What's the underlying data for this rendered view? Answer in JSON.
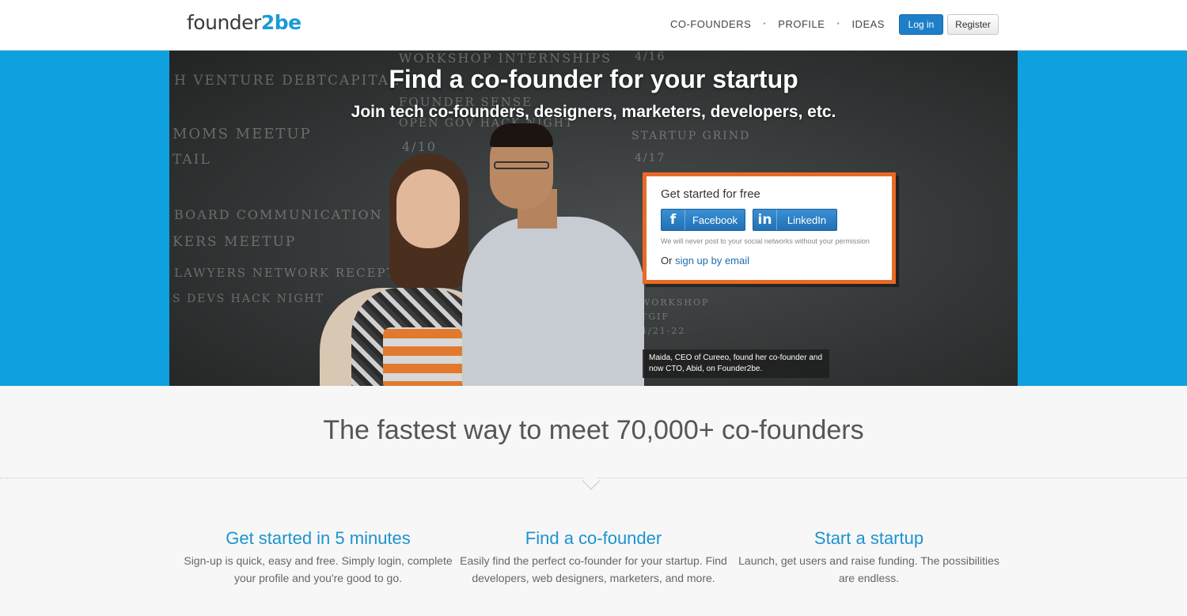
{
  "header": {
    "logo_main": "founder",
    "logo_accent": "2be",
    "nav": [
      "CO-FOUNDERS",
      "PROFILE",
      "IDEAS"
    ],
    "nav_separator": "•",
    "login_label": "Log in",
    "register_label": "Register"
  },
  "hero": {
    "title": "Find a co-founder for your startup",
    "subtitle": "Join tech co-founders, designers, marketers, developers, etc.",
    "chalk": [
      "WORKSHOP INTERNSHIPS",
      "H VENTURE DEBTCAPITAL",
      "FOUNDER SENSE",
      "MOMS MEETUP",
      "OPEN GOV HACK NIGHT",
      "TAIL",
      "BOARD COMMUNICATION",
      "KERS MEETUP",
      "LAWYERS NETWORK RECEPT",
      "S DEVS HACK NIGHT",
      "4/16",
      "4/10",
      "STARTUP GRIND",
      "4/17",
      "WORKSHOP",
      "TGIF",
      "4/21-22"
    ],
    "caption": "Maida, CEO of Cureeo, found her co-founder and now CTO, Abid, on Founder2be."
  },
  "signup": {
    "title": "Get started for free",
    "facebook_icon": "f",
    "facebook_label": "Facebook",
    "linkedin_icon": "in",
    "linkedin_label": "LinkedIn",
    "note": "We will never post to your social networks without your permission",
    "email_prefix": "Or",
    "email_link": "sign up by email"
  },
  "main": {
    "tagline": "The fastest way to meet 70,000+ co-founders",
    "features": [
      {
        "title": "Get started in 5 minutes",
        "text": "Sign-up is quick, easy and free. Simply login, complete your profile and you're good to go."
      },
      {
        "title": "Find a co-founder",
        "text": "Easily find the perfect co-founder for your startup. Find developers, web designers, marketers, and more."
      },
      {
        "title": "Start a startup",
        "text": "Launch, get users and raise funding. The possibilities are endless."
      }
    ]
  },
  "colors": {
    "accent": "#1b9ad6",
    "hero_band": "#0fa0e0",
    "signup_border": "#e86a26",
    "login_button": "#1e7fc9"
  },
  "icons": [
    "facebook-icon",
    "linkedin-icon"
  ]
}
